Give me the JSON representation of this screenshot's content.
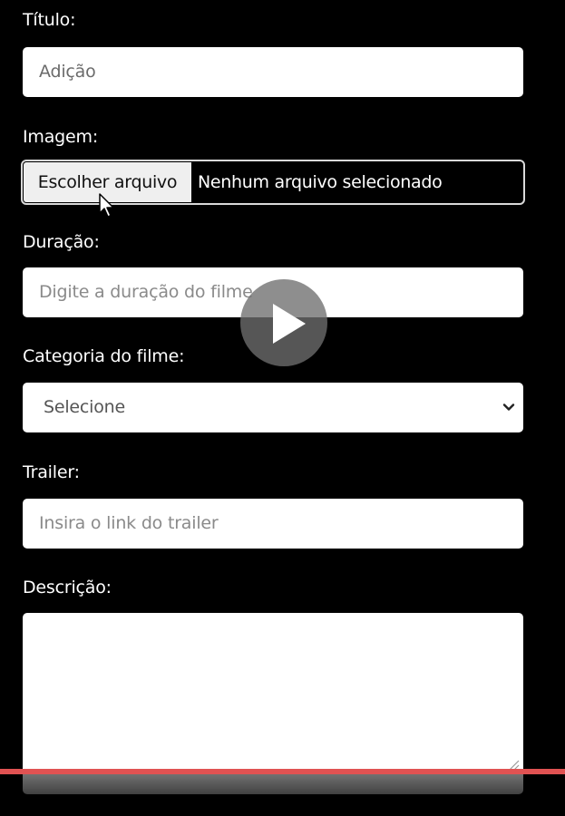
{
  "form": {
    "titulo": {
      "label": "Título:",
      "value": "Adição"
    },
    "imagem": {
      "label": "Imagem:",
      "button_label": "Escolher arquivo",
      "status": "Nenhum arquivo selecionado"
    },
    "duracao": {
      "label": "Duração:",
      "placeholder": "Digite a duração do filme"
    },
    "categoria": {
      "label": "Categoria do filme:",
      "selected": "Selecione",
      "icon": "chevron-down-icon"
    },
    "trailer": {
      "label": "Trailer:",
      "placeholder": "Insira o link do trailer"
    },
    "descricao": {
      "label": "Descrição:",
      "value": ""
    }
  },
  "video_player": {
    "play_icon": "play-icon",
    "progress_color": "#e05252",
    "progress_fraction": 1.0
  },
  "colors": {
    "background": "#000000",
    "input_background": "#ffffff",
    "label_text": "#ffffff",
    "placeholder_text": "#8a8a8a"
  }
}
